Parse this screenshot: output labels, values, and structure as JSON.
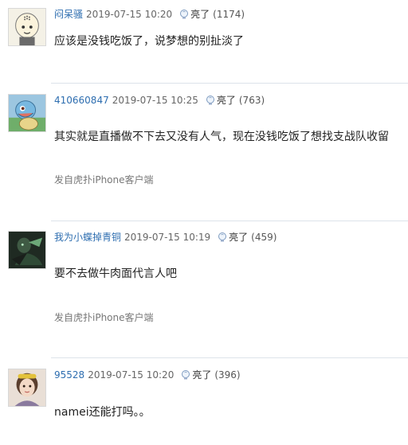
{
  "comments": [
    {
      "username": "闷呆骚",
      "time": "2019-07-15 10:20",
      "light_label": "亮了",
      "light_count": "(1174)",
      "content": "应该是没钱吃饭了，说梦想的别扯淡了",
      "source": "",
      "avatar_icon": "bald-cartoon-avatar-icon"
    },
    {
      "username": "410660847",
      "time": "2019-07-15 10:25",
      "light_label": "亮了",
      "light_count": "(763)",
      "content": "其实就是直播做不下去又没有人气，现在没钱吃饭了想找支战队收留",
      "source": "发自虎扑iPhone客户端",
      "avatar_icon": "squirtle-avatar-icon"
    },
    {
      "username": "我为小蝶掉青铜",
      "time": "2019-07-15 10:19",
      "light_label": "亮了",
      "light_count": "(459)",
      "content": "要不去做牛肉面代言人吧",
      "source": "发自虎扑iPhone客户端",
      "avatar_icon": "game-character-avatar-icon"
    },
    {
      "username": "95528",
      "time": "2019-07-15 10:20",
      "light_label": "亮了",
      "light_count": "(396)",
      "content": "namei还能打吗。。",
      "source": "",
      "avatar_icon": "girl-photo-avatar-icon"
    }
  ],
  "colors": {
    "username": "#2e6eb0",
    "divider": "#dde3ea",
    "text": "#222222",
    "muted": "#777777"
  }
}
